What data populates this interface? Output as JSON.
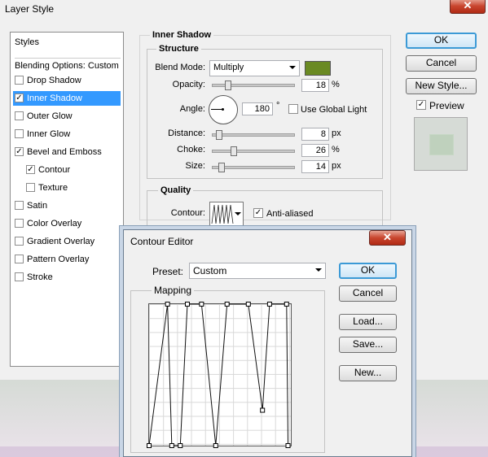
{
  "layer_style": {
    "title": "Layer Style",
    "styles_header": "Styles",
    "blending_options": "Blending Options: Custom",
    "items": [
      {
        "label": "Drop Shadow",
        "checked": false,
        "selected": false,
        "indent": false
      },
      {
        "label": "Inner Shadow",
        "checked": true,
        "selected": true,
        "indent": false
      },
      {
        "label": "Outer Glow",
        "checked": false,
        "selected": false,
        "indent": false
      },
      {
        "label": "Inner Glow",
        "checked": false,
        "selected": false,
        "indent": false
      },
      {
        "label": "Bevel and Emboss",
        "checked": true,
        "selected": false,
        "indent": false
      },
      {
        "label": "Contour",
        "checked": true,
        "selected": false,
        "indent": true
      },
      {
        "label": "Texture",
        "checked": false,
        "selected": false,
        "indent": true
      },
      {
        "label": "Satin",
        "checked": false,
        "selected": false,
        "indent": false
      },
      {
        "label": "Color Overlay",
        "checked": false,
        "selected": false,
        "indent": false
      },
      {
        "label": "Gradient Overlay",
        "checked": false,
        "selected": false,
        "indent": false
      },
      {
        "label": "Pattern Overlay",
        "checked": false,
        "selected": false,
        "indent": false
      },
      {
        "label": "Stroke",
        "checked": false,
        "selected": false,
        "indent": false
      }
    ],
    "inner_shadow": {
      "section_title": "Inner Shadow",
      "structure_title": "Structure",
      "blend_mode_label": "Blend Mode:",
      "blend_mode": "Multiply",
      "color": "#6a8a23",
      "opacity_label": "Opacity:",
      "opacity": "18",
      "opacity_unit": "%",
      "angle_label": "Angle:",
      "angle": "180",
      "angle_unit": "°",
      "global_light_label": "Use Global Light",
      "distance_label": "Distance:",
      "distance": "8",
      "distance_unit": "px",
      "choke_label": "Choke:",
      "choke": "26",
      "choke_unit": "%",
      "size_label": "Size:",
      "size": "14",
      "size_unit": "px",
      "quality_title": "Quality",
      "contour_label": "Contour:",
      "anti_aliased_label": "Anti-aliased"
    },
    "buttons": {
      "ok": "OK",
      "cancel": "Cancel",
      "new_style": "New Style...",
      "preview": "Preview"
    }
  },
  "contour_editor": {
    "title": "Contour Editor",
    "preset_label": "Preset:",
    "preset_value": "Custom",
    "mapping_label": "Mapping",
    "buttons": {
      "ok": "OK",
      "cancel": "Cancel",
      "load": "Load...",
      "save": "Save...",
      "new": "New..."
    },
    "curve_points": [
      [
        0,
        1
      ],
      [
        0.13,
        0
      ],
      [
        0.16,
        1
      ],
      [
        0.22,
        1
      ],
      [
        0.27,
        0
      ],
      [
        0.37,
        0
      ],
      [
        0.47,
        1
      ],
      [
        0.55,
        0
      ],
      [
        0.7,
        0
      ],
      [
        0.8,
        0.75
      ],
      [
        0.85,
        0
      ],
      [
        0.97,
        0
      ],
      [
        0.98,
        1
      ]
    ]
  }
}
